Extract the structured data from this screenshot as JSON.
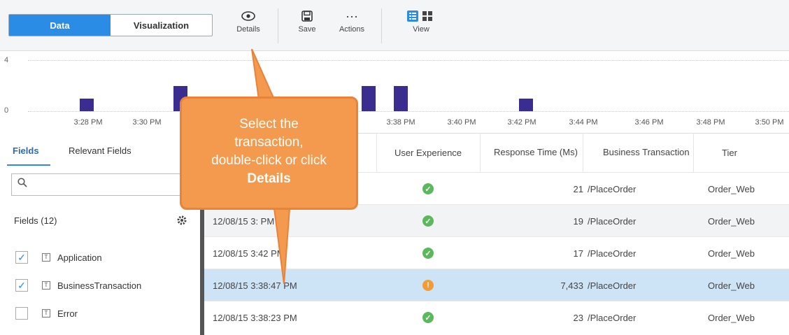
{
  "toolbar": {
    "toggle": {
      "data_label": "Data",
      "visualization_label": "Visualization"
    },
    "details_label": "Details",
    "save_label": "Save",
    "actions_label": "Actions",
    "view_label": "View"
  },
  "histogram": {
    "y_max": "4",
    "y_min": "0",
    "x_ticks": [
      "3:28 PM",
      "3:30 PM",
      "3:38 PM",
      "3:40 PM",
      "3:42 PM",
      "3:44 PM",
      "3:46 PM",
      "3:48 PM",
      "3:50 PM"
    ],
    "bars": [
      {
        "time": "3:27 PM",
        "count": 1
      },
      {
        "time": "3:31 PM",
        "count": 2
      },
      {
        "time": "3:36 PM",
        "count": 2
      },
      {
        "time": "3:37 PM",
        "count": 2
      },
      {
        "time": "3:41 PM",
        "count": 1
      }
    ]
  },
  "left": {
    "tabs": [
      "Fields",
      "Relevant Fields"
    ],
    "fields_title": "Fields (12)",
    "fields": [
      {
        "name": "Application",
        "checked": true
      },
      {
        "name": "BusinessTransaction",
        "checked": true
      },
      {
        "name": "Error",
        "checked": false
      }
    ]
  },
  "table": {
    "headers": [
      "User Experience",
      "Response Time (Ms)",
      "Business Transaction",
      "Tier"
    ],
    "rows": [
      {
        "time": "",
        "status": "ok",
        "response": "21",
        "bt": "/PlaceOrder",
        "tier": "Order_Web"
      },
      {
        "time": "12/08/15 3:  PM",
        "status": "ok",
        "response": "19",
        "bt": "/PlaceOrder",
        "tier": "Order_Web"
      },
      {
        "time": "12/08/15 3:42  PM",
        "status": "ok",
        "response": "17",
        "bt": "/PlaceOrder",
        "tier": "Order_Web"
      },
      {
        "time": "12/08/15 3:38:47 PM",
        "status": "warn",
        "response": "7,433",
        "bt": "/PlaceOrder",
        "tier": "Order_Web"
      },
      {
        "time": "12/08/15 3:38:23 PM",
        "status": "ok",
        "response": "23",
        "bt": "/PlaceOrder",
        "tier": "Order_Web"
      }
    ]
  },
  "callout": {
    "line1": "Select the",
    "line2": "transaction,",
    "line3": "double-click or click",
    "line4": "Details"
  },
  "colors": {
    "accent": "#2b8ce6",
    "bar": "#3b2d8f",
    "callout": "#f39a4e",
    "ok": "#5cb85c",
    "warn": "#f39c35",
    "selected_row": "#cde4f7"
  }
}
